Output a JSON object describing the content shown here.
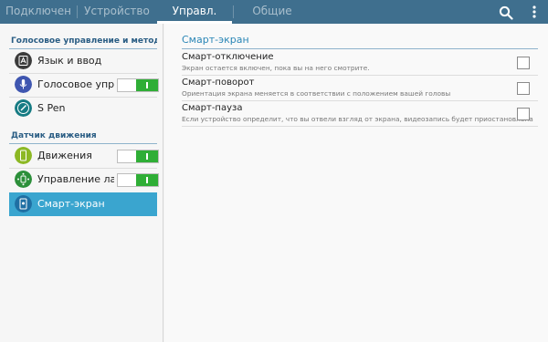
{
  "tabs": [
    {
      "label": "Подключения",
      "active": false
    },
    {
      "label": "Устройство",
      "active": false
    },
    {
      "label": "Управл.",
      "active": true
    },
    {
      "label": "Общие",
      "active": false
    }
  ],
  "toolbar": {
    "search_icon": "search-icon",
    "more_icon": "more-vert-icon"
  },
  "sidebar": {
    "sections": [
      {
        "header": "Голосовое управление и методы в...",
        "items": [
          {
            "label": "Язык и ввод",
            "icon": "keyboard-icon",
            "switch": null,
            "selected": false
          },
          {
            "label": "Голосовое управление",
            "icon": "microphone-icon",
            "switch": "on",
            "selected": false
          },
          {
            "label": "S Pen",
            "icon": "pen-icon",
            "switch": null,
            "selected": false
          }
        ]
      },
      {
        "header": "Датчик движения",
        "items": [
          {
            "label": "Движения",
            "icon": "phone-motion-icon",
            "switch": "on",
            "selected": false
          },
          {
            "label": "Управление ладонью",
            "icon": "palm-icon",
            "switch": "on",
            "selected": false
          },
          {
            "label": "Смарт-экран",
            "icon": "smart-screen-icon",
            "switch": null,
            "selected": true
          }
        ]
      }
    ]
  },
  "main": {
    "title": "Смарт-экран",
    "options": [
      {
        "title": "Смарт-отключение",
        "subtitle": "Экран остается включен, пока вы на него смотрите.",
        "checked": false
      },
      {
        "title": "Смарт-поворот",
        "subtitle": "Ориентация экрана меняется в соответствии с положением вашей головы",
        "checked": false
      },
      {
        "title": "Смарт-пауза",
        "subtitle": "Если устройство определит, что вы отвели взгляд от экрана, видеозапись будет приостановлена",
        "checked": false
      }
    ]
  },
  "colors": {
    "topbar": "#3f6f8e",
    "accent": "#3aa5cf",
    "switch_on": "#2fae36",
    "section_header": "#2a5d84"
  }
}
